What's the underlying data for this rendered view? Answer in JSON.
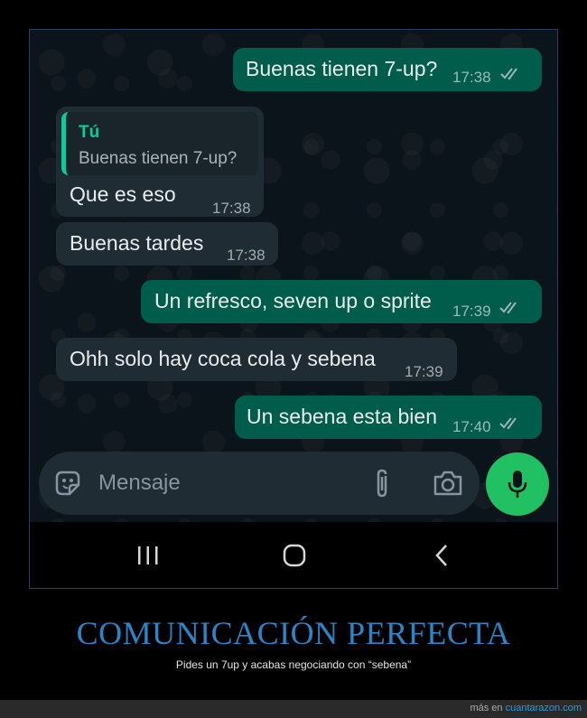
{
  "messages": [
    {
      "direction": "out",
      "text": "Buenas tienen 7-up?",
      "time": "17:38",
      "status": "read"
    },
    {
      "direction": "in",
      "quote": {
        "author": "Tú",
        "text": "Buenas tienen 7-up?"
      },
      "text": "Que es eso",
      "time": "17:38"
    },
    {
      "direction": "in",
      "text": "Buenas tardes",
      "time": "17:38"
    },
    {
      "direction": "out",
      "text": "Un refresco, seven up o sprite",
      "time": "17:39",
      "status": "read"
    },
    {
      "direction": "in",
      "text": "Ohh solo hay coca cola y sebena",
      "time": "17:39"
    },
    {
      "direction": "out",
      "text": "Un sebena esta bien",
      "time": "17:40",
      "status": "read"
    }
  ],
  "composer": {
    "placeholder": "Mensaje",
    "icons": [
      "sticker-icon",
      "paperclip-icon",
      "camera-icon",
      "microphone-icon"
    ]
  },
  "navbar": {
    "icons": [
      "recent-apps-icon",
      "home-icon",
      "back-icon"
    ]
  },
  "caption": {
    "title": "COMUNICACIÓN PERFECTA",
    "subtitle": "Pides un 7up y acabas negociando con “sebena”"
  },
  "footer": {
    "prefix": "más en",
    "link": "cuantarazon.com"
  },
  "colors": {
    "outgoing_bubble": "#005c4b",
    "incoming_bubble": "#202c33",
    "quote_accent": "#06cf9c",
    "mic_button": "#21c063",
    "caption_title": "#2a86c8"
  }
}
